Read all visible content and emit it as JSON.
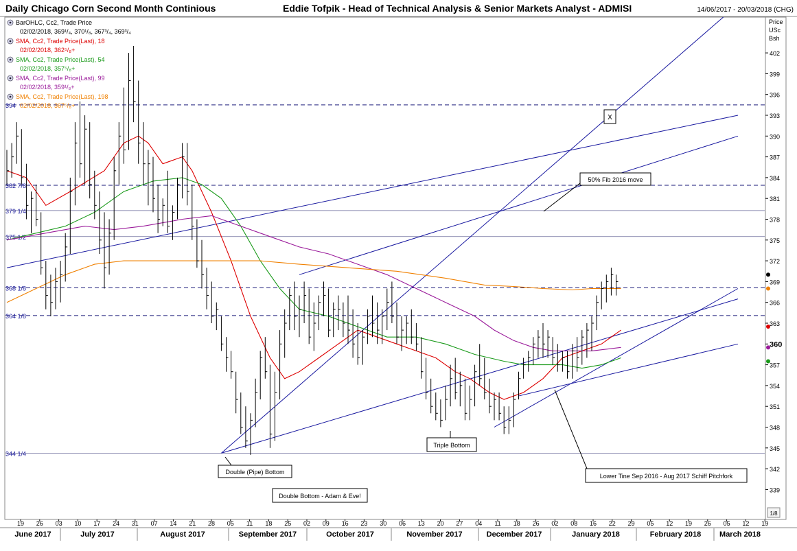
{
  "header": {
    "title": "Daily Chicago Corn Second Month Continious",
    "author": "Eddie Tofpik - Head of Technical Analysis & Senior Markets Analyst - ADMISI",
    "date_range": "14/06/2017 - 20/03/2018 (CHG)"
  },
  "price_axis": {
    "header_lines": [
      "Price",
      "USc",
      "Bsh"
    ],
    "tick_labels": [
      "402",
      "399",
      "396",
      "393",
      "390",
      "387",
      "384",
      "381",
      "378",
      "375",
      "372",
      "369",
      "366",
      "363",
      "360",
      "357",
      "354",
      "351",
      "348",
      "345",
      "342",
      "339"
    ],
    "scale_button": "1/8"
  },
  "legend": [
    {
      "title": "BarOHLC, Cc2, Trade Price",
      "value": "02/02/2018, 369¹/₄, 370¹/₈, 367³/₄, 369³/₄",
      "color": "#000000",
      "icon": "eye-icon"
    },
    {
      "title": "SMA, Cc2, Trade Price(Last), 18",
      "value": "02/02/2018, 362⁵/₈+",
      "color": "#dd0000",
      "icon": "eye-icon"
    },
    {
      "title": "SMA, Cc2, Trade Price(Last), 54",
      "value": "02/02/2018, 357⁵/₈+",
      "color": "#1a9a1a",
      "icon": "eye-icon"
    },
    {
      "title": "SMA, Cc2, Trade Price(Last), 99",
      "value": "02/02/2018, 359¹/₈+",
      "color": "#9a1a9a",
      "icon": "eye-icon"
    },
    {
      "title": "SMA, Cc2, Trade Price(Last), 198",
      "value": "02/02/2018, 367⁵/₈+",
      "color": "#f08000",
      "icon": "eye-icon"
    }
  ],
  "chart_data": {
    "type": "bar",
    "ylim": [
      338,
      405
    ],
    "yticks": [
      402,
      399,
      396,
      393,
      390,
      387,
      384,
      381,
      378,
      375,
      372,
      369,
      366,
      363,
      360,
      357,
      354,
      351,
      348,
      345,
      342,
      339
    ],
    "x_day_labels": [
      "19",
      "26",
      "03",
      "10",
      "17",
      "24",
      "31",
      "07",
      "14",
      "21",
      "28",
      "05",
      "11",
      "18",
      "25",
      "02",
      "09",
      "16",
      "23",
      "30",
      "06",
      "13",
      "20",
      "27",
      "04",
      "11",
      "18",
      "26",
      "02",
      "08",
      "16",
      "22",
      "29",
      "05",
      "12",
      "19",
      "26",
      "05",
      "12",
      "19"
    ],
    "months": [
      "June 2017",
      "July 2017",
      "August 2017",
      "September 2017",
      "October 2017",
      "November 2017",
      "December 2017",
      "January 2018",
      "February 2018",
      "March 2018"
    ],
    "hlines": [
      {
        "label": "394",
        "y": 394.5,
        "style": "dashed"
      },
      {
        "label": "382 7/8",
        "y": 382.9,
        "style": "dashed"
      },
      {
        "label": "379 1/4",
        "y": 379.25,
        "style": "solid"
      },
      {
        "label": "375 1/2",
        "y": 375.5,
        "style": "solid"
      },
      {
        "label": "368 1/8",
        "y": 368.1,
        "style": "dashed"
      },
      {
        "label": "364 1/8",
        "y": 364.1,
        "style": "dashed"
      },
      {
        "label": "344 1/4",
        "y": 344.25,
        "style": "solid"
      }
    ],
    "annotations": [
      "X",
      "50% Fib 2016 move",
      "Double (Pipe) Bottom",
      "Double Bottom - Adam & Eve!",
      "Triple Bottom",
      "Lower Tine Sep 2016 - Aug 2017 Schiff Pitchfork"
    ],
    "bars": [
      {
        "h": 388,
        "l": 383,
        "c": 385
      },
      {
        "h": 389,
        "l": 384,
        "c": 387
      },
      {
        "h": 392,
        "l": 386,
        "c": 390
      },
      {
        "h": 391,
        "l": 383,
        "c": 384
      },
      {
        "h": 386,
        "l": 378,
        "c": 380
      },
      {
        "h": 382,
        "l": 376,
        "c": 381
      },
      {
        "h": 383,
        "l": 377,
        "c": 378
      },
      {
        "h": 379,
        "l": 370,
        "c": 371
      },
      {
        "h": 372,
        "l": 365,
        "c": 367
      },
      {
        "h": 370,
        "l": 364,
        "c": 366
      },
      {
        "h": 371,
        "l": 365,
        "c": 369
      },
      {
        "h": 372,
        "l": 366,
        "c": 370
      },
      {
        "h": 376,
        "l": 369,
        "c": 374
      },
      {
        "h": 384,
        "l": 373,
        "c": 382
      },
      {
        "h": 392,
        "l": 380,
        "c": 389
      },
      {
        "h": 395,
        "l": 384,
        "c": 386
      },
      {
        "h": 393,
        "l": 383,
        "c": 391
      },
      {
        "h": 392,
        "l": 381,
        "c": 383
      },
      {
        "h": 385,
        "l": 378,
        "c": 380
      },
      {
        "h": 382,
        "l": 373,
        "c": 375
      },
      {
        "h": 379,
        "l": 368,
        "c": 371
      },
      {
        "h": 378,
        "l": 370,
        "c": 376
      },
      {
        "h": 387,
        "l": 375,
        "c": 385
      },
      {
        "h": 392,
        "l": 383,
        "c": 390
      },
      {
        "h": 397,
        "l": 386,
        "c": 388
      },
      {
        "h": 402,
        "l": 388,
        "c": 398
      },
      {
        "h": 403,
        "l": 392,
        "c": 395
      },
      {
        "h": 398,
        "l": 386,
        "c": 389
      },
      {
        "h": 392,
        "l": 383,
        "c": 386
      },
      {
        "h": 388,
        "l": 380,
        "c": 386
      },
      {
        "h": 387,
        "l": 379,
        "c": 381
      },
      {
        "h": 383,
        "l": 376,
        "c": 378
      },
      {
        "h": 381,
        "l": 377,
        "c": 380
      },
      {
        "h": 385,
        "l": 376,
        "c": 377
      },
      {
        "h": 380,
        "l": 375,
        "c": 379
      },
      {
        "h": 384,
        "l": 378,
        "c": 383
      },
      {
        "h": 389,
        "l": 381,
        "c": 387
      },
      {
        "h": 389,
        "l": 380,
        "c": 382
      },
      {
        "h": 383,
        "l": 375,
        "c": 377
      },
      {
        "h": 378,
        "l": 371,
        "c": 372
      },
      {
        "h": 375,
        "l": 368,
        "c": 370
      },
      {
        "h": 371,
        "l": 365,
        "c": 367
      },
      {
        "h": 369,
        "l": 363,
        "c": 364
      },
      {
        "h": 366,
        "l": 362,
        "c": 365
      },
      {
        "h": 364,
        "l": 359,
        "c": 360
      },
      {
        "h": 361,
        "l": 356,
        "c": 358
      },
      {
        "h": 359,
        "l": 355,
        "c": 356
      },
      {
        "h": 356,
        "l": 350,
        "c": 352
      },
      {
        "h": 353,
        "l": 347,
        "c": 348
      },
      {
        "h": 351,
        "l": 345,
        "c": 346
      },
      {
        "h": 350,
        "l": 344,
        "c": 349
      },
      {
        "h": 355,
        "l": 348,
        "c": 353
      },
      {
        "h": 359,
        "l": 352,
        "c": 358
      },
      {
        "h": 361,
        "l": 355,
        "c": 356
      },
      {
        "h": 357,
        "l": 345,
        "c": 347
      },
      {
        "h": 356,
        "l": 346,
        "c": 353
      },
      {
        "h": 362,
        "l": 352,
        "c": 360
      },
      {
        "h": 365,
        "l": 358,
        "c": 363
      },
      {
        "h": 368,
        "l": 362,
        "c": 367
      },
      {
        "h": 369,
        "l": 362,
        "c": 364
      },
      {
        "h": 367,
        "l": 361,
        "c": 365
      },
      {
        "h": 369,
        "l": 363,
        "c": 367
      },
      {
        "h": 368,
        "l": 360,
        "c": 361
      },
      {
        "h": 366,
        "l": 359,
        "c": 363
      },
      {
        "h": 367,
        "l": 362,
        "c": 366
      },
      {
        "h": 369,
        "l": 364,
        "c": 367
      },
      {
        "h": 368,
        "l": 361,
        "c": 362
      },
      {
        "h": 366,
        "l": 361,
        "c": 365
      },
      {
        "h": 367,
        "l": 362,
        "c": 365
      },
      {
        "h": 366,
        "l": 361,
        "c": 363
      },
      {
        "h": 367,
        "l": 360,
        "c": 362
      },
      {
        "h": 365,
        "l": 358,
        "c": 360
      },
      {
        "h": 363,
        "l": 357,
        "c": 358
      },
      {
        "h": 362,
        "l": 357,
        "c": 361
      },
      {
        "h": 365,
        "l": 360,
        "c": 364
      },
      {
        "h": 367,
        "l": 361,
        "c": 363
      },
      {
        "h": 366,
        "l": 360,
        "c": 362
      },
      {
        "h": 365,
        "l": 360,
        "c": 364
      },
      {
        "h": 368,
        "l": 362,
        "c": 366
      },
      {
        "h": 369,
        "l": 363,
        "c": 364
      },
      {
        "h": 366,
        "l": 360,
        "c": 361
      },
      {
        "h": 364,
        "l": 359,
        "c": 362
      },
      {
        "h": 364,
        "l": 360,
        "c": 363
      },
      {
        "h": 365,
        "l": 360,
        "c": 361
      },
      {
        "h": 363,
        "l": 359,
        "c": 360
      },
      {
        "h": 361,
        "l": 355,
        "c": 356
      },
      {
        "h": 358,
        "l": 352,
        "c": 353
      },
      {
        "h": 355,
        "l": 350,
        "c": 351
      },
      {
        "h": 353,
        "l": 349,
        "c": 350
      },
      {
        "h": 352,
        "l": 348,
        "c": 349
      },
      {
        "h": 354,
        "l": 349,
        "c": 352
      },
      {
        "h": 357,
        "l": 351,
        "c": 355
      },
      {
        "h": 358,
        "l": 352,
        "c": 353
      },
      {
        "h": 356,
        "l": 351,
        "c": 354
      },
      {
        "h": 355,
        "l": 349,
        "c": 350
      },
      {
        "h": 354,
        "l": 349,
        "c": 352
      },
      {
        "h": 357,
        "l": 351,
        "c": 356
      },
      {
        "h": 360,
        "l": 354,
        "c": 355
      },
      {
        "h": 358,
        "l": 352,
        "c": 353
      },
      {
        "h": 355,
        "l": 350,
        "c": 351
      },
      {
        "h": 353,
        "l": 349,
        "c": 352
      },
      {
        "h": 353,
        "l": 349,
        "c": 350
      },
      {
        "h": 351,
        "l": 347,
        "c": 348
      },
      {
        "h": 351,
        "l": 347,
        "c": 349
      },
      {
        "h": 353,
        "l": 348,
        "c": 352
      },
      {
        "h": 356,
        "l": 352,
        "c": 355
      },
      {
        "h": 358,
        "l": 355,
        "c": 357
      },
      {
        "h": 359,
        "l": 356,
        "c": 358
      },
      {
        "h": 361,
        "l": 357,
        "c": 360
      },
      {
        "h": 362,
        "l": 358,
        "c": 361
      },
      {
        "h": 363,
        "l": 358,
        "c": 360
      },
      {
        "h": 362,
        "l": 358,
        "c": 361
      },
      {
        "h": 361,
        "l": 357,
        "c": 358
      },
      {
        "h": 360,
        "l": 356,
        "c": 357
      },
      {
        "h": 359,
        "l": 356,
        "c": 358
      },
      {
        "h": 359,
        "l": 355,
        "c": 356
      },
      {
        "h": 360,
        "l": 355,
        "c": 359
      },
      {
        "h": 361,
        "l": 356,
        "c": 358
      },
      {
        "h": 362,
        "l": 357,
        "c": 361
      },
      {
        "h": 363,
        "l": 358,
        "c": 362
      },
      {
        "h": 364,
        "l": 359,
        "c": 363
      },
      {
        "h": 367,
        "l": 362,
        "c": 366
      },
      {
        "h": 369,
        "l": 365,
        "c": 368
      },
      {
        "h": 370,
        "l": 366,
        "c": 369
      },
      {
        "h": 371,
        "l": 367,
        "c": 370
      },
      {
        "h": 370,
        "l": 367,
        "c": 369
      }
    ],
    "series": [
      {
        "name": "SMA 18",
        "color": "#dd0000",
        "points": [
          [
            0,
            385
          ],
          [
            4,
            384
          ],
          [
            8,
            380
          ],
          [
            13,
            382
          ],
          [
            20,
            385
          ],
          [
            24,
            389
          ],
          [
            27,
            390
          ],
          [
            29,
            389
          ],
          [
            32,
            386
          ],
          [
            36,
            387
          ],
          [
            38,
            385
          ],
          [
            42,
            379
          ],
          [
            46,
            372
          ],
          [
            50,
            364
          ],
          [
            54,
            358
          ],
          [
            57,
            355
          ],
          [
            60,
            356
          ],
          [
            64,
            358
          ],
          [
            68,
            360
          ],
          [
            72,
            362
          ],
          [
            76,
            361
          ],
          [
            80,
            360
          ],
          [
            84,
            359
          ],
          [
            88,
            358
          ],
          [
            92,
            356
          ],
          [
            95,
            355
          ],
          [
            99,
            353
          ],
          [
            102,
            352
          ],
          [
            106,
            353
          ],
          [
            110,
            355
          ],
          [
            114,
            358
          ],
          [
            118,
            359
          ],
          [
            122,
            360
          ],
          [
            126,
            362
          ]
        ]
      },
      {
        "name": "SMA 54",
        "color": "#1a9a1a",
        "points": [
          [
            0,
            375
          ],
          [
            6,
            376
          ],
          [
            12,
            377
          ],
          [
            18,
            379
          ],
          [
            24,
            382
          ],
          [
            30,
            383.5
          ],
          [
            36,
            384
          ],
          [
            40,
            383
          ],
          [
            44,
            381
          ],
          [
            48,
            377
          ],
          [
            52,
            372
          ],
          [
            56,
            368
          ],
          [
            60,
            365
          ],
          [
            66,
            364
          ],
          [
            72,
            362.5
          ],
          [
            78,
            361
          ],
          [
            84,
            361
          ],
          [
            90,
            360
          ],
          [
            96,
            358.5
          ],
          [
            102,
            357.5
          ],
          [
            106,
            357
          ],
          [
            110,
            357
          ],
          [
            114,
            357
          ],
          [
            118,
            356.5
          ],
          [
            122,
            357
          ],
          [
            126,
            358
          ]
        ]
      },
      {
        "name": "SMA 99",
        "color": "#9a1a9a",
        "points": [
          [
            0,
            375
          ],
          [
            8,
            376
          ],
          [
            16,
            377
          ],
          [
            22,
            376.5
          ],
          [
            28,
            377
          ],
          [
            36,
            378
          ],
          [
            42,
            378.5
          ],
          [
            48,
            377
          ],
          [
            54,
            375.5
          ],
          [
            60,
            374
          ],
          [
            66,
            373
          ],
          [
            72,
            371.5
          ],
          [
            78,
            370
          ],
          [
            84,
            368
          ],
          [
            90,
            366
          ],
          [
            96,
            364
          ],
          [
            100,
            362
          ],
          [
            104,
            360.5
          ],
          [
            108,
            359.5
          ],
          [
            112,
            359
          ],
          [
            116,
            359
          ],
          [
            120,
            359
          ],
          [
            126,
            359.5
          ]
        ]
      },
      {
        "name": "SMA 198",
        "color": "#f08000",
        "points": [
          [
            0,
            366
          ],
          [
            6,
            368
          ],
          [
            12,
            370
          ],
          [
            18,
            371.5
          ],
          [
            24,
            372
          ],
          [
            30,
            372
          ],
          [
            36,
            372
          ],
          [
            44,
            372
          ],
          [
            52,
            372
          ],
          [
            60,
            371.5
          ],
          [
            70,
            371
          ],
          [
            80,
            370.5
          ],
          [
            90,
            369.5
          ],
          [
            98,
            368.5
          ],
          [
            104,
            368.3
          ],
          [
            110,
            368
          ],
          [
            116,
            367.8
          ],
          [
            120,
            368
          ],
          [
            126,
            368
          ]
        ]
      }
    ],
    "trendlines": [
      {
        "x1": 0,
        "y1": 371,
        "x2": 150,
        "y2": 393
      },
      {
        "x1": 44,
        "y1": 344.25,
        "x2": 150,
        "y2": 409
      },
      {
        "x1": 60,
        "y1": 370,
        "x2": 150,
        "y2": 390
      },
      {
        "x1": 44,
        "y1": 344.25,
        "x2": 150,
        "y2": 366.5
      },
      {
        "x1": 100,
        "y1": 348,
        "x2": 150,
        "y2": 368
      },
      {
        "x1": 105,
        "y1": 352.5,
        "x2": 150,
        "y2": 360
      }
    ],
    "right_markers": [
      {
        "y": 370,
        "color": "#000000"
      },
      {
        "y": 368,
        "color": "#f08000"
      },
      {
        "y": 362.5,
        "color": "#dd0000"
      },
      {
        "y": 359.5,
        "color": "#9a1a9a"
      },
      {
        "y": 357.5,
        "color": "#1a9a1a"
      }
    ]
  }
}
